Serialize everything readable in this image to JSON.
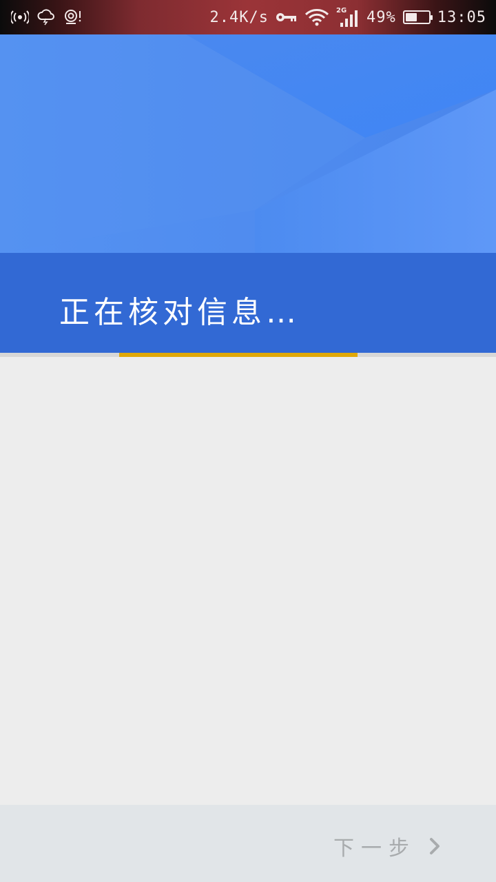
{
  "status_bar": {
    "icons_left": [
      "hotspot-icon",
      "weather-storm-icon",
      "nfc-alert-icon"
    ],
    "net_speed": "2.4K/s",
    "network_type": "2G",
    "battery_percent_text": "49%",
    "battery_level": 0.49,
    "time": "13:05",
    "icons_right": [
      "key-icon",
      "wifi-icon",
      "signal-icon",
      "battery-icon"
    ]
  },
  "header": {
    "title": "正在核对信息…"
  },
  "progress": {
    "start_fraction": 0.24,
    "fraction": 0.48,
    "color": "#e0a808"
  },
  "footer": {
    "next_label": "下一步",
    "next_icon": "chevron-right-icon"
  },
  "colors": {
    "header_blue": "#4f8bef",
    "band_blue": "#3269d4",
    "background": "#ededed",
    "footer_bg": "#e1e5e8",
    "disabled_text": "#a8abad"
  }
}
